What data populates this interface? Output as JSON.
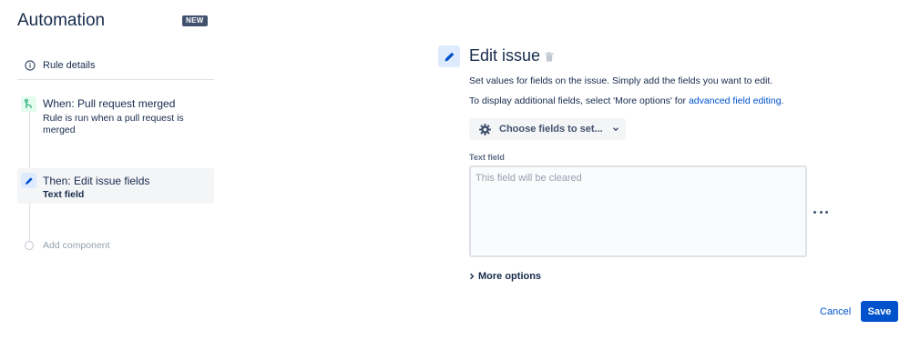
{
  "app": {
    "title": "Automation",
    "badge": "NEW"
  },
  "sidebar": {
    "rule_details": {
      "label": "Rule details",
      "icon": "info-icon"
    },
    "steps": [
      {
        "title": "When: Pull request merged",
        "description": "Rule is run when a pull request is merged",
        "icon": "pull-request-merged-icon",
        "icon_color": "#36b37e"
      },
      {
        "title": "Then: Edit issue fields",
        "subtitle": "Text field",
        "icon": "pencil-icon",
        "icon_color": "#0052cc"
      }
    ],
    "add_component": {
      "label": "Add component"
    }
  },
  "editor": {
    "title": "Edit issue",
    "description": "Set values for fields on the issue. Simply add the fields you want to edit.",
    "hint_prefix": "To display additional fields, select 'More options' for ",
    "hint_link": "advanced field editing",
    "hint_suffix": ".",
    "choose_fields_label": "Choose fields to set...",
    "field": {
      "label": "Text field",
      "value": "",
      "placeholder": "This field will be cleared"
    },
    "more_options_label": "More options"
  },
  "footer": {
    "cancel_label": "Cancel",
    "save_label": "Save"
  },
  "colors": {
    "primary": "#0052cc",
    "text": "#172b4d",
    "muted": "#97a0af",
    "badge": "#42526e"
  }
}
